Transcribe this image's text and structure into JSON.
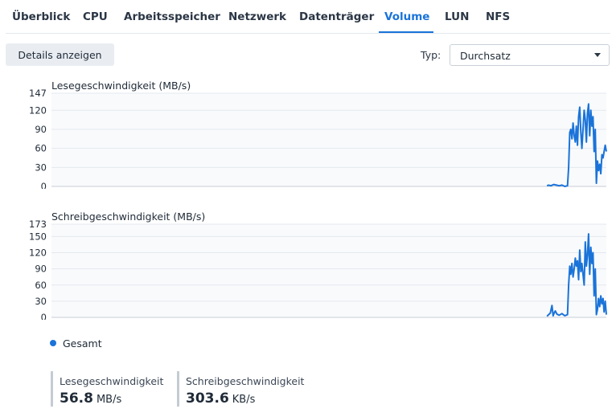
{
  "tabs": [
    {
      "label": "Überblick"
    },
    {
      "label": "CPU"
    },
    {
      "label": "Arbeitsspeicher"
    },
    {
      "label": "Netzwerk"
    },
    {
      "label": "Datenträger"
    },
    {
      "label": "Volume",
      "active": true
    },
    {
      "label": "LUN"
    },
    {
      "label": "NFS"
    }
  ],
  "toolbar": {
    "details_label": "Details anzeigen",
    "type_label": "Typ:",
    "type_value": "Durchsatz"
  },
  "colors": {
    "accent": "#1a73d9",
    "series": "#1a73d9",
    "grid": "#e4e8ee",
    "plot_bg": "#f9fafc"
  },
  "legend": {
    "label": "Gesamt"
  },
  "stats": [
    {
      "label": "Lesegeschwindigkeit",
      "value": "56.8",
      "unit": "MB/s"
    },
    {
      "label": "Schreibgeschwindigkeit",
      "value": "303.6",
      "unit": "KB/s"
    }
  ],
  "chart_data": [
    {
      "type": "line",
      "title": "Lesegeschwindigkeit (MB/s)",
      "ylim": [
        0,
        147
      ],
      "yticks": [
        0,
        30,
        60,
        90,
        120,
        147
      ],
      "xlim": [
        0,
        1
      ],
      "grid": true,
      "series": [
        {
          "name": "Gesamt",
          "x": [
            0.893,
            0.896,
            0.9,
            0.905,
            0.91,
            0.915,
            0.92,
            0.925,
            0.93,
            0.932,
            0.934,
            0.936,
            0.938,
            0.94,
            0.942,
            0.944,
            0.946,
            0.948,
            0.95,
            0.952,
            0.954,
            0.956,
            0.958,
            0.96,
            0.962,
            0.964,
            0.966,
            0.968,
            0.97,
            0.972,
            0.974,
            0.976,
            0.978,
            0.98,
            0.982,
            0.984,
            0.986,
            0.988,
            0.99,
            0.992,
            0.994,
            0.996,
            0.998,
            1.0
          ],
          "y": [
            1,
            2,
            1,
            3,
            2,
            1,
            2,
            0,
            1,
            30,
            85,
            90,
            75,
            100,
            80,
            70,
            95,
            65,
            110,
            125,
            85,
            60,
            90,
            120,
            105,
            70,
            115,
            130,
            80,
            120,
            95,
            110,
            55,
            90,
            5,
            40,
            25,
            35,
            20,
            50,
            45,
            55,
            65,
            55
          ]
        }
      ]
    },
    {
      "type": "line",
      "title": "Schreibgeschwindigkeit (MB/s)",
      "ylim": [
        0,
        173
      ],
      "yticks": [
        0,
        30,
        60,
        90,
        120,
        150,
        173
      ],
      "xlim": [
        0,
        1
      ],
      "grid": true,
      "series": [
        {
          "name": "Gesamt",
          "x": [
            0.893,
            0.896,
            0.899,
            0.902,
            0.904,
            0.906,
            0.908,
            0.911,
            0.915,
            0.92,
            0.925,
            0.93,
            0.932,
            0.934,
            0.936,
            0.938,
            0.94,
            0.942,
            0.944,
            0.946,
            0.948,
            0.95,
            0.952,
            0.954,
            0.956,
            0.958,
            0.96,
            0.962,
            0.964,
            0.966,
            0.968,
            0.97,
            0.972,
            0.974,
            0.976,
            0.978,
            0.98,
            0.982,
            0.984,
            0.986,
            0.988,
            0.99,
            0.992,
            0.994,
            0.996,
            0.998,
            1.0
          ],
          "y": [
            2,
            5,
            8,
            22,
            3,
            8,
            12,
            6,
            4,
            7,
            3,
            5,
            60,
            95,
            80,
            100,
            75,
            90,
            110,
            95,
            105,
            70,
            125,
            85,
            100,
            80,
            60,
            140,
            95,
            115,
            155,
            80,
            130,
            100,
            120,
            40,
            90,
            5,
            15,
            35,
            20,
            40,
            25,
            35,
            10,
            30,
            5
          ]
        }
      ]
    }
  ]
}
